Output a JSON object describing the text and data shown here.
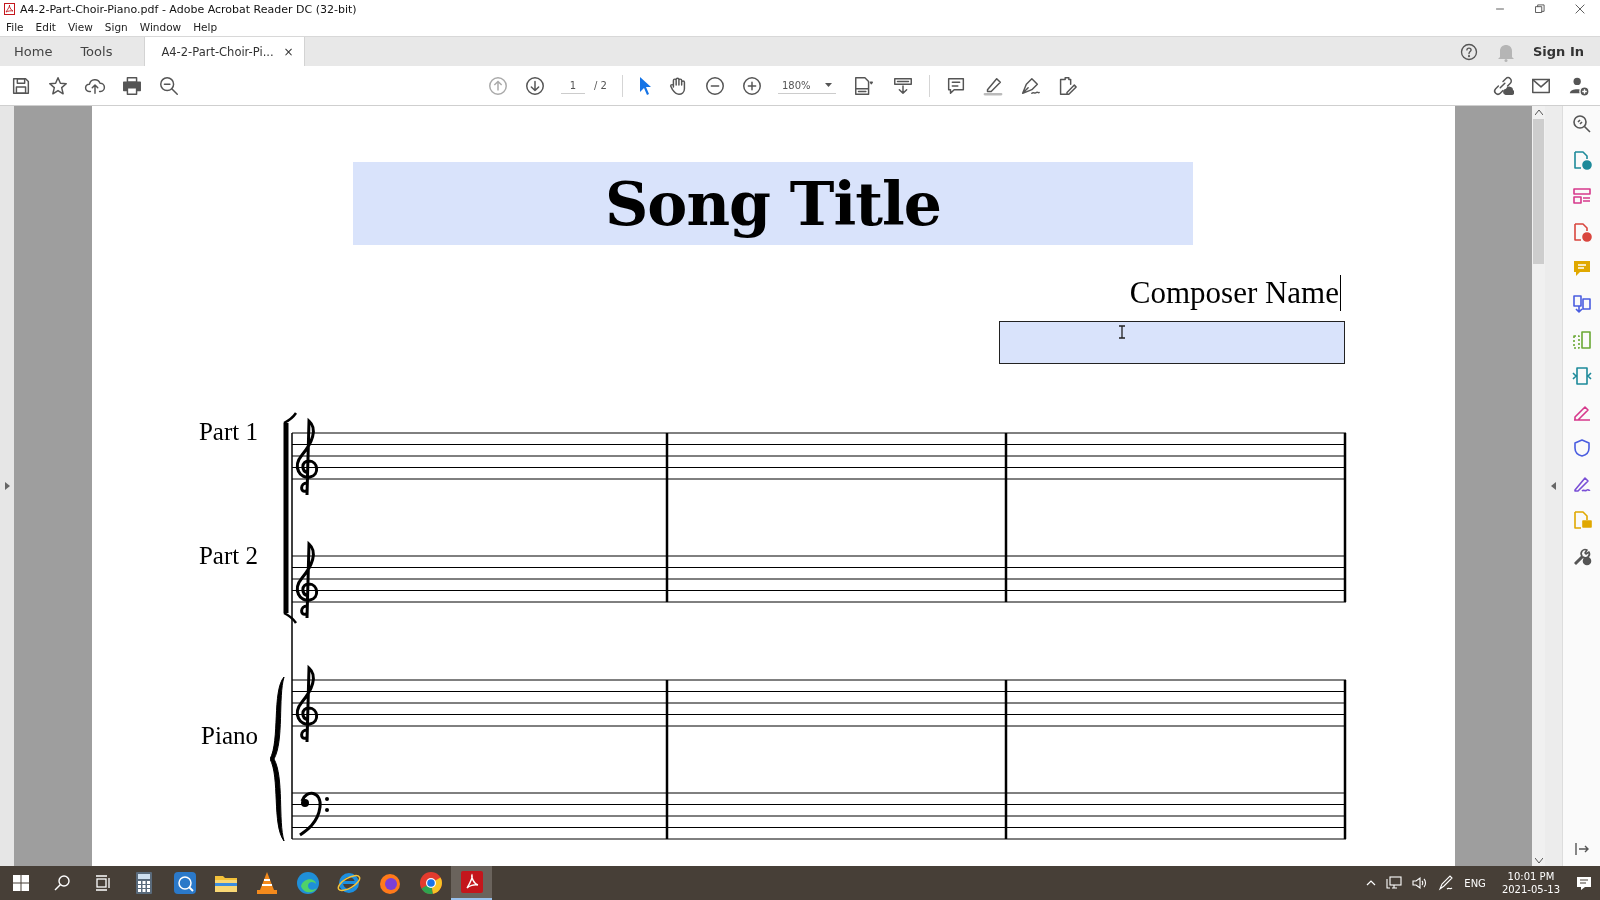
{
  "window": {
    "title": "A4-2-Part-Choir-Piano.pdf - Adobe Acrobat Reader DC (32-bit)"
  },
  "menu": [
    "File",
    "Edit",
    "View",
    "Sign",
    "Window",
    "Help"
  ],
  "tabs": [
    {
      "label": "Home",
      "selected": false
    },
    {
      "label": "Tools",
      "selected": false
    },
    {
      "label": "A4-2-Part-Choir-Pi...",
      "selected": true,
      "close": "×"
    }
  ],
  "header_right": {
    "sign_in": "Sign In"
  },
  "toolbar": {
    "page": "1",
    "page_total": "/ 2",
    "zoom": "180%"
  },
  "document": {
    "title": "Song Title",
    "composer": "Composer Name",
    "parts": [
      {
        "label": "Part 1"
      },
      {
        "label": "Part 2"
      },
      {
        "label": "Piano"
      }
    ]
  },
  "taskbar": {
    "apps": [
      {
        "kind": "calculator",
        "selected": false
      },
      {
        "kind": "dictionary",
        "selected": false
      },
      {
        "kind": "folder",
        "selected": false
      },
      {
        "kind": "cone",
        "selected": false
      },
      {
        "kind": "edge",
        "selected": false
      },
      {
        "kind": "ie",
        "selected": false
      },
      {
        "kind": "firefox",
        "selected": false
      },
      {
        "kind": "chrome",
        "selected": false
      },
      {
        "kind": "acrobat",
        "selected": true
      }
    ],
    "language": "ENG",
    "time": "10:01 PM",
    "date": "2021-05-13"
  }
}
